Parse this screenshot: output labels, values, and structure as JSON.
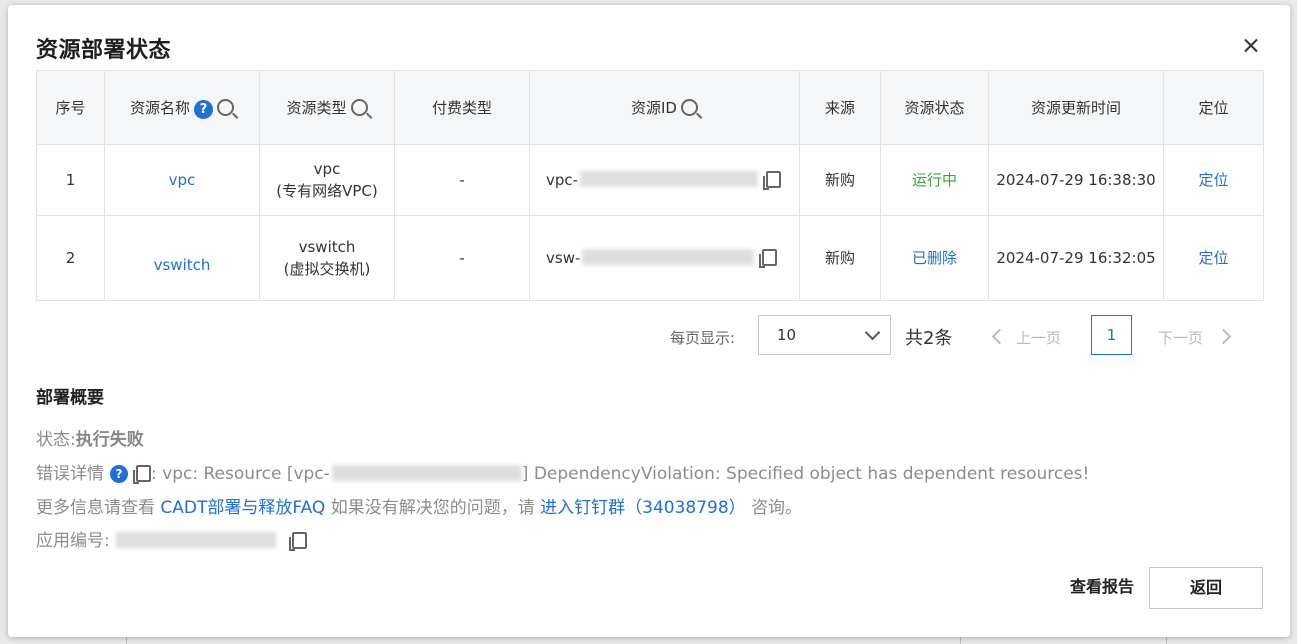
{
  "dialog": {
    "title": "资源部署状态"
  },
  "table": {
    "headers": {
      "index": "序号",
      "name": "资源名称",
      "type": "资源类型",
      "pay": "付费类型",
      "id": "资源ID",
      "source": "来源",
      "status": "资源状态",
      "updated": "资源更新时间",
      "locate": "定位"
    },
    "rows": [
      {
        "index": "1",
        "name": "vpc",
        "type": "vpc",
        "type_desc": "(专有网络VPC)",
        "pay": "-",
        "id_prefix": "vpc-",
        "source": "新购",
        "status": "运行中",
        "status_color": "#3aa53a",
        "updated": "2024-07-29 16:38:30",
        "locate": "定位"
      },
      {
        "index": "2",
        "name": "vswitch",
        "type": "vswitch",
        "type_desc": "(虚拟交换机)",
        "pay": "-",
        "id_prefix": "vsw-",
        "source": "新购",
        "status": "已删除",
        "status_color": "#1f6fd6",
        "updated": "2024-07-29 16:32:05",
        "locate": "定位"
      }
    ]
  },
  "pagination": {
    "page_size_label": "每页显示:",
    "page_size": "10",
    "total": "共2条",
    "prev": "上一页",
    "current_page": "1",
    "next": "下一页"
  },
  "summary": {
    "heading": "部署概要",
    "status_label": "状态:",
    "status_value": "执行失败",
    "error_label": "错误详情",
    "error_prefix": ": vpc: Resource [vpc-",
    "error_suffix": "] DependencyViolation: Specified object has dependent resources!",
    "more_prefix": "更多信息请查看",
    "faq_link": "CADT部署与释放FAQ",
    "more_middle": "如果没有解决您的问题，请",
    "group_link": "进入钉钉群（34038798）",
    "more_suffix": "咨询。",
    "app_id_label": "应用编号:"
  },
  "footer": {
    "report_button": "查看报告",
    "back_button": "返回"
  },
  "colors": {
    "accent": "#1f6fd6",
    "running": "#3aa53a"
  }
}
